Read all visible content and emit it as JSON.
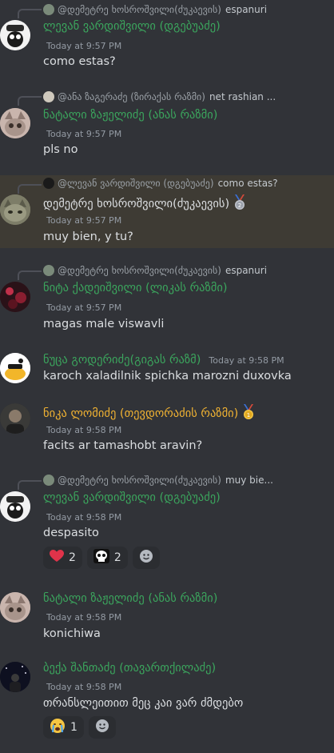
{
  "colors": {
    "background": "#313338",
    "name_green": "#3ba55d",
    "name_yellow": "#f0b232",
    "highlight": "#3e3b34"
  },
  "messages": [
    {
      "reply": {
        "name": "@დემეტრე ხოსროშვილი(ძუკაევის)",
        "text": "espanuri"
      },
      "author": "ლევან ვარდიშვილი (დგებუაძე)",
      "time": "Today at 9:57 PM",
      "text": "como estas?"
    },
    {
      "reply": {
        "name": "@ანა ზაგერაძე (ზირაქას რაზმი)",
        "text": "net rashian ..."
      },
      "author": "ნატალი ზაჟელიძე (ანას რაზმი)",
      "time": "Today at 9:57 PM",
      "text": "pls no"
    },
    {
      "reply": {
        "name": "@ლევან ვარდიშვილი (დგებუაძე)",
        "text": "como estas?"
      },
      "author": "დემეტრე ხოსროშვილი(ძუკაევის)",
      "badge": "2",
      "time": "Today at 9:57 PM",
      "text": "muy bien, y tu?"
    },
    {
      "reply": {
        "name": "@დემეტრე ხოსროშვილი(ძუკაევის)",
        "text": "espanuri"
      },
      "author": "ნიტა ქადეიშვილი (ლიკას რაზმი)",
      "time": "Today at 9:57 PM",
      "text": "magas male viswavli"
    },
    {
      "author": "ნუცა გოდერიძე(გიგას რაზმ)",
      "time": "Today at 9:58 PM",
      "text": "karoch xaladilnik spichka marozni duxovka"
    },
    {
      "author": "ნიკა ლომიძე (თევდორაძის რაზმი)",
      "badge": "1",
      "time": "Today at 9:58 PM",
      "text": "facits ar tamashobt aravin?"
    },
    {
      "reply": {
        "name": "@დემეტრე ხოსროშვილი(ძუკაევის)",
        "text": "muy bie..."
      },
      "author": "ლევან ვარდიშვილი (დგებუაძე)",
      "time": "Today at 9:58 PM",
      "text": "despasito",
      "reactions": [
        {
          "emoji": "heart",
          "count": "2"
        },
        {
          "emoji": "skull",
          "count": "2"
        }
      ]
    },
    {
      "author": "ნატალი ზაჟელიძე (ანას რაზმი)",
      "time": "Today at 9:58 PM",
      "text": "konichiwa"
    },
    {
      "author": "ბექა შანთაძე (თავართქილაძე)",
      "time": "Today at 9:58 PM",
      "text": "თრანსლეითით მეც კაი ვარ ძმდებო",
      "reactions": [
        {
          "emoji": "crying-face",
          "count": "1"
        }
      ]
    }
  ]
}
